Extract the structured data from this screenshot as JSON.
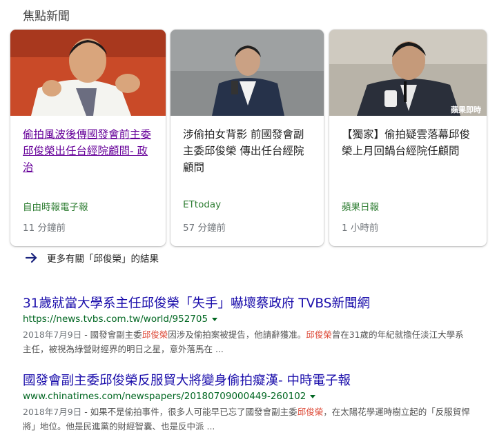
{
  "section": {
    "title": "焦點新聞"
  },
  "cards": [
    {
      "headline": "偷拍風波後傳國發會前主委邱俊榮出任台經院顧問- 政治",
      "source": "自由時報電子報",
      "time": "11 分鐘前"
    },
    {
      "headline": "涉偷拍女背影 前國發會副主委邱俊榮 傳出任台經院顧問",
      "source": "ETtoday",
      "time": "57 分鐘前"
    },
    {
      "headline": "【獨家】偷拍疑雲落幕邱俊榮上月回鍋台經院任顧問",
      "source": "蘋果日報",
      "time": "1 小時前"
    }
  ],
  "thumb_watermark": "蘋果即時",
  "more": {
    "label": "更多有關「邱俊榮」的結果"
  },
  "results": [
    {
      "title": "31歲就當大學系主任邱俊榮「失手」嚇壞蔡政府 TVBS新聞網",
      "url": "https://news.tvbs.com.tw/world/952705",
      "date": "2018年7月9日",
      "snip_a": " - 國發會副主委",
      "snip_hl_a": "邱俊榮",
      "snip_b": "因涉及偷拍案被提告，他請辭獲准。",
      "snip_hl_b": "邱俊榮",
      "snip_c": "曾在31歲的年紀就擔任淡江大學系主任，被視為綠營財經界的明日之星，意外落馬在 ..."
    },
    {
      "title": "國發會副主委邱俊榮反服貿大將變身偷拍癡漢- 中時電子報",
      "url": "www.chinatimes.com/newspapers/20180709000449-260102",
      "date": "2018年7月9日",
      "snip_a": " - 如果不是偷拍事件，很多人可能早已忘了國發會副主委",
      "snip_hl_a": "邱俊榮",
      "snip_b": "，在太陽花學運時樹立起的「反服貿悍將」地位。他是民進黨的財經智囊、也是反中派 ..."
    }
  ]
}
